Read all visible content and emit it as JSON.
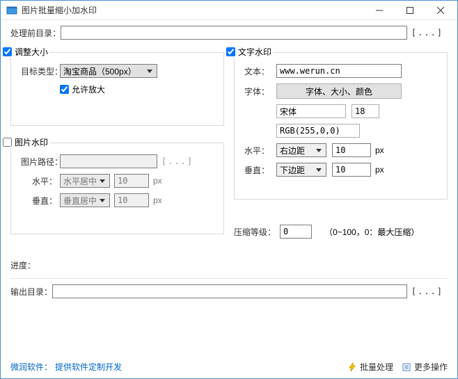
{
  "window": {
    "title": "图片批量缩小加水印"
  },
  "dir_in": {
    "label": "处理前目录：",
    "value": "",
    "browse": "[...]"
  },
  "resize": {
    "legend": "调整大小",
    "checked": true,
    "type_label": "目标类型：",
    "type_value": "淘宝商品（500px）",
    "allow_enlarge": "允许放大",
    "allow_enlarge_checked": true
  },
  "img_wm": {
    "legend": "图片水印",
    "checked": false,
    "path_label": "图片路径：",
    "path_value": "",
    "browse": "[...]",
    "h_label": "水平：",
    "h_value": "水平居中",
    "h_offset": "10",
    "v_label": "垂直：",
    "v_value": "垂直居中",
    "v_offset": "10",
    "px": "px"
  },
  "text_wm": {
    "legend": "文字水印",
    "checked": true,
    "text_label": "文本：",
    "text_value": "www.werun.cn",
    "font_label": "字体：",
    "font_btn": "字体、大小、颜色",
    "font_name": "宋体",
    "font_size": "18",
    "font_color": "RGB(255,0,0)",
    "h_label": "水平：",
    "h_value": "右边距",
    "h_offset": "10",
    "v_label": "垂直：",
    "v_value": "下边距",
    "v_offset": "10",
    "px": "px"
  },
  "compress": {
    "label": "压缩等级：",
    "value": "0",
    "hint": "（0~100，0：最大压缩）"
  },
  "progress": {
    "label": "进度："
  },
  "dir_out": {
    "label": "输出目录：",
    "value": "",
    "browse": "[...]"
  },
  "footer": {
    "company": "微润软件：",
    "link": "提供软件定制开发",
    "batch": "批量处理",
    "more": "更多操作"
  }
}
